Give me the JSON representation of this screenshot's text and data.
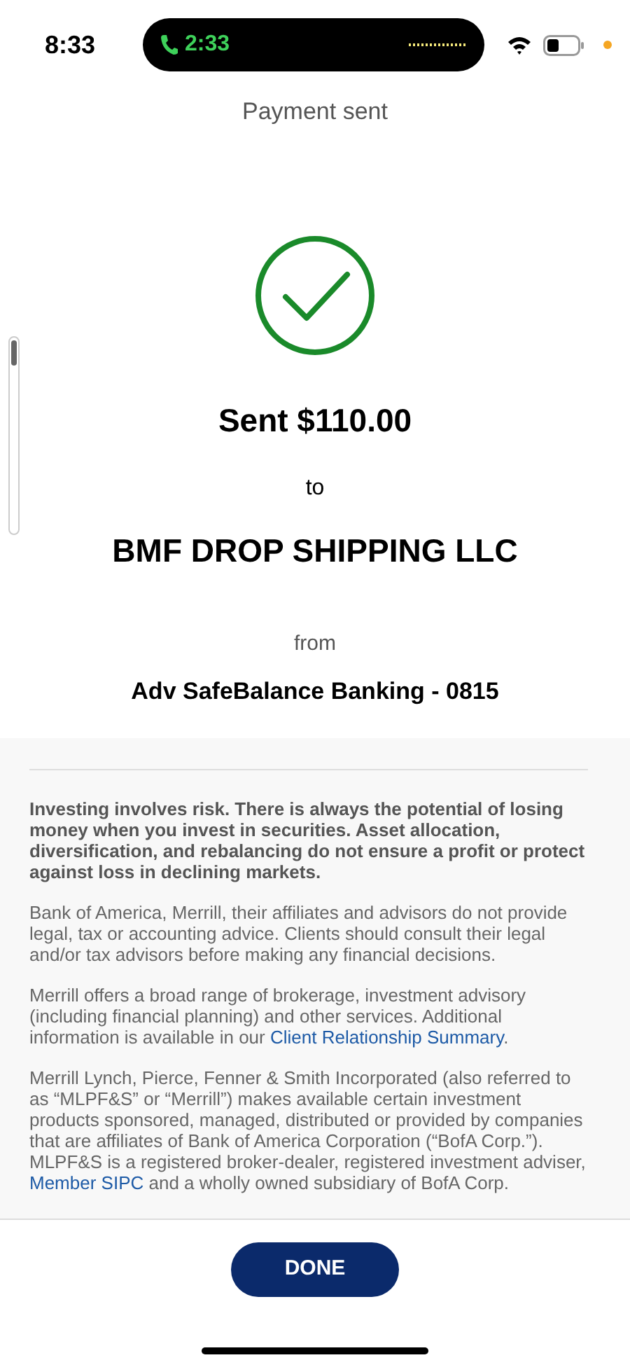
{
  "status_bar": {
    "time": "8:33",
    "call_time": "2:33"
  },
  "title": "Payment sent",
  "confirmation": {
    "amount": "Sent $110.00",
    "to_label": "to",
    "payee": "BMF DROP SHIPPING LLC",
    "from_label": "from",
    "account": "Adv SafeBalance Banking - 0815"
  },
  "disclosures": [
    {
      "kind": "bold",
      "segments": [
        {
          "text": "Investing involves risk. There is always the potential of losing money when you invest in securities. Asset allocation, diversification, and rebalancing do not ensure a profit or protect against loss in declining markets.",
          "link": false
        }
      ]
    },
    {
      "kind": "plain",
      "segments": [
        {
          "text": "Bank of America, Merrill, their affiliates and advisors do not provide legal, tax or accounting advice. Clients should consult their legal and/or tax advisors before making any financial decisions.",
          "link": false
        }
      ]
    },
    {
      "kind": "plain",
      "segments": [
        {
          "text": "Merrill offers a broad range of brokerage, investment advisory (including financial planning) and other services. Additional information is available in our ",
          "link": false
        },
        {
          "text": "Client Relationship Summary",
          "link": true
        },
        {
          "text": ".",
          "link": false
        }
      ]
    },
    {
      "kind": "plain",
      "segments": [
        {
          "text": "Merrill Lynch, Pierce, Fenner & Smith Incorporated (also referred to as “MLPF&S” or “Merrill”) makes available certain investment products sponsored, managed, distributed or provided by companies that are affiliates of Bank of America Corporation (“BofA Corp.”). MLPF&S is a registered broker-dealer, registered investment adviser, ",
          "link": false
        },
        {
          "text": "Member SIPC",
          "link": true
        },
        {
          "text": " and a wholly owned subsidiary of BofA Corp.",
          "link": false
        }
      ]
    }
  ],
  "done_button": "DONE"
}
